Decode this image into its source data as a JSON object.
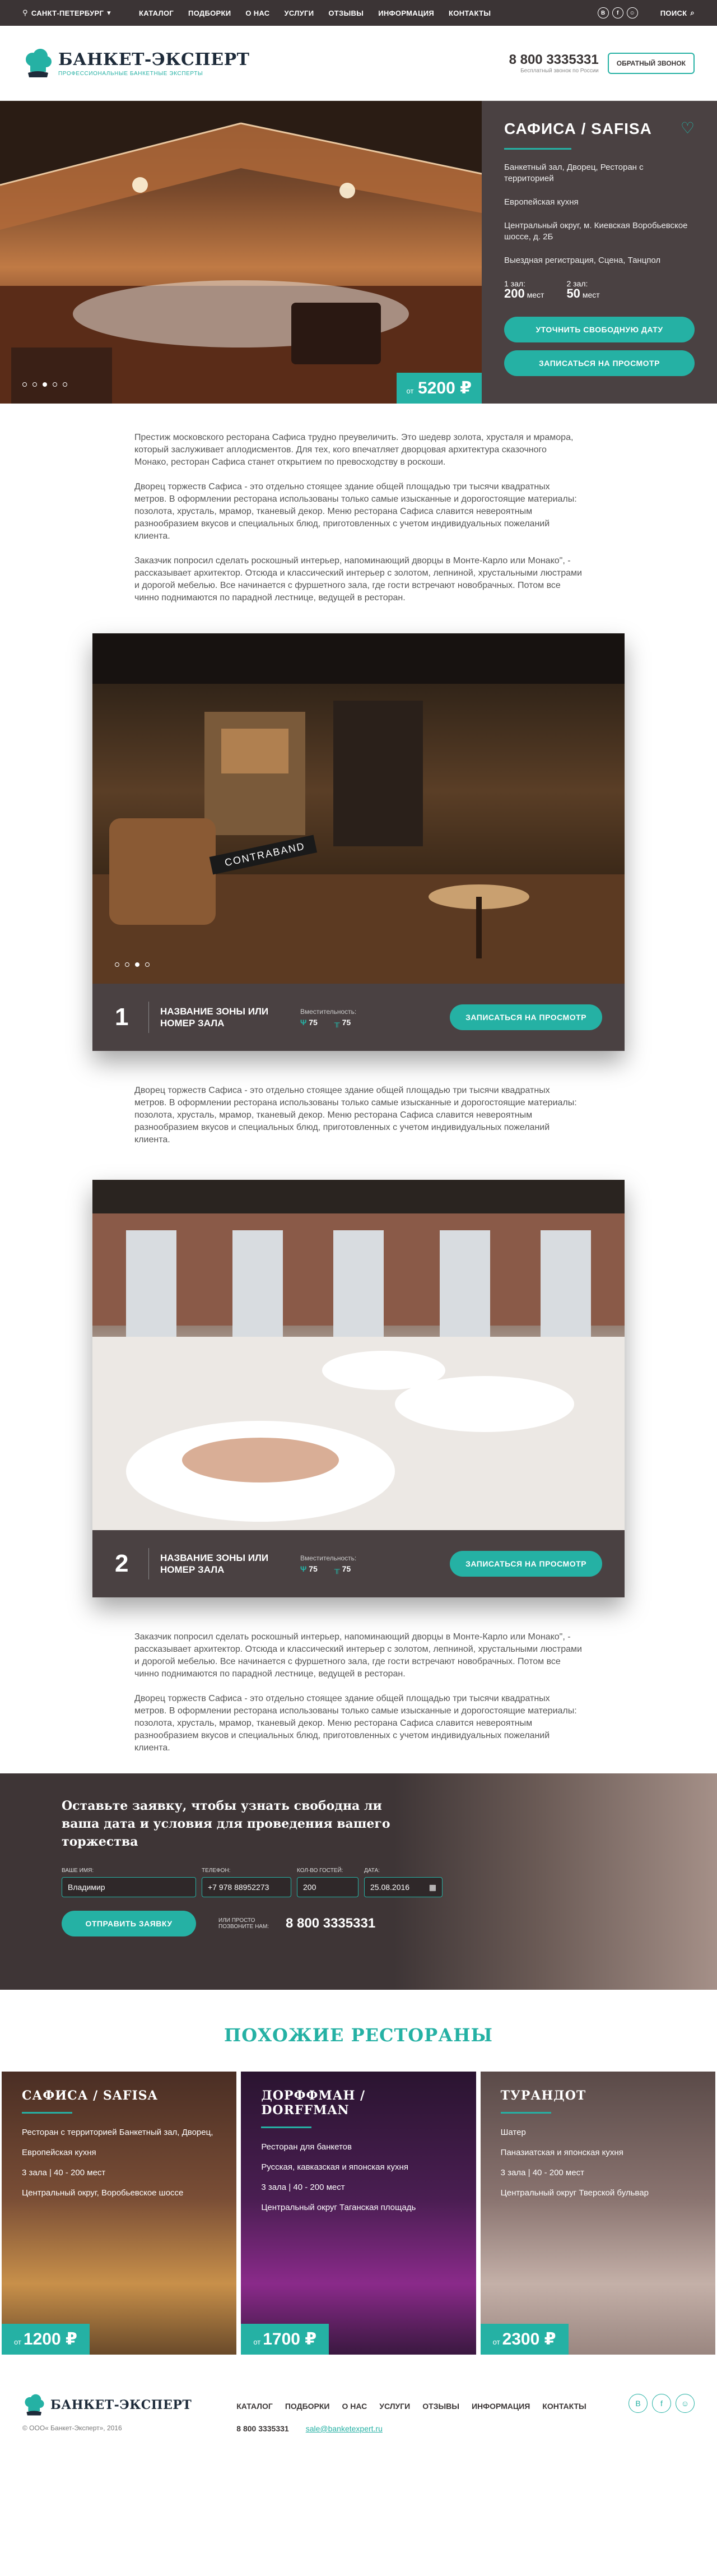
{
  "topbar": {
    "city": "САНКТ-ПЕТЕРБУРГ",
    "nav": [
      "КАТАЛОГ",
      "ПОДБОРКИ",
      "О НАС",
      "УСЛУГИ",
      "ОТЗЫВЫ",
      "ИНФОРМАЦИЯ",
      "КОНТАКТЫ"
    ],
    "social": [
      "В",
      "f",
      "☺"
    ],
    "search": "ПОИСК"
  },
  "header": {
    "logo_title": "БАНКЕТ-ЭКСПЕРТ",
    "logo_subtitle": "ПРОФЕССИОНАЛЬНЫЕ БАНКЕТНЫЕ ЭКСПЕРТЫ",
    "phone": "8 800 3335331",
    "phone_note": "Бесплатный звонок по России",
    "callback": "ОБРАТНЫЙ ЗВОНОК"
  },
  "hero": {
    "name": "САФИСА / SAFISA",
    "type": "Банкетный зал, Дворец, Ресторан с территорией",
    "cuisine": "Европейская кухня",
    "address": "Центральный округ, м. Киевская Воробьевское шоссе, д. 2Б",
    "extra": "Выездная регистрация, Сцена, Танцпол",
    "hall1_label": "1 зал:",
    "hall1_val": "200",
    "hall1_unit": "мест",
    "hall2_label": "2 зал:",
    "hall2_val": "50",
    "hall2_unit": "мест",
    "btn_date": "УТОЧНИТЬ СВОБОДНУЮ ДАТУ",
    "btn_view": "ЗАПИСАТЬСЯ НА ПРОСМОТР",
    "price_prefix": "от",
    "price": "5200 ₽"
  },
  "text1": [
    "Престиж московского ресторана Сафиса трудно преувеличить. Это шедевр золота, хрусталя и мрамора, который заслуживает аплодисментов. Для тех, кого впечатляет дворцовая архитектура сказочного Монако, ресторан Сафиса станет открытием по превосходству в роскоши.",
    "Дворец торжеств Сафиса - это отдельно стоящее здание общей площадью три тысячи квадратных метров. В оформлении ресторана использованы только самые изысканные и дорогостоящие материалы: позолота, хрусталь, мрамор, тканевый декор. Меню ресторана Сафиса славится невероятным разнообразием вкусов и специальных блюд, приготовленных с учетом индивидуальных пожеланий клиента.",
    "Заказчик попросил сделать роскошный интерьер, напоминающий дворцы в Монте-Карло или Монако\", - рассказывает архитектор. Отсюда и классический интерьер с золотом, лепниной, хрустальными люстрами и дорогой мебелью. Все начинается с фуршетного зала, где гости встречают новобрачных. Потом все чинно поднимаются по парадной лестнице, ведущей в ресторан."
  ],
  "zones": [
    {
      "num": "1",
      "name": "НАЗВАНИЕ ЗОНЫ ИЛИ НОМЕР ЗАЛА",
      "cap_label": "Вместительность:",
      "cap1": "75",
      "cap2": "75",
      "btn": "ЗАПИСАТЬСЯ НА ПРОСМОТР",
      "sign": "CONTRABAND"
    },
    {
      "num": "2",
      "name": "НАЗВАНИЕ ЗОНЫ ИЛИ НОМЕР ЗАЛА",
      "cap_label": "Вместительность:",
      "cap1": "75",
      "cap2": "75",
      "btn": "ЗАПИСАТЬСЯ НА ПРОСМОТР"
    }
  ],
  "text2": [
    "Дворец торжеств Сафиса - это отдельно стоящее здание общей площадью три тысячи квадратных метров. В оформлении ресторана использованы только самые изысканные и дорогостоящие материалы: позолота, хрусталь, мрамор, тканевый декор. Меню ресторана Сафиса славится невероятным разнообразием вкусов и специальных блюд, приготовленных с учетом индивидуальных пожеланий клиента."
  ],
  "text3": [
    "Заказчик попросил сделать роскошный интерьер, напоминающий дворцы в Монте-Карло или Монако\", - рассказывает архитектор. Отсюда и классический интерьер с золотом, лепниной, хрустальными люстрами и дорогой мебелью. Все начинается с фуршетного зала, где гости встречают новобрачных. Потом все чинно поднимаются по парадной лестнице, ведущей в ресторан.",
    "Дворец торжеств Сафиса - это отдельно стоящее здание общей площадью три тысячи квадратных метров. В оформлении ресторана использованы только самые изысканные и дорогостоящие материалы: позолота, хрусталь, мрамор, тканевый декор. Меню ресторана Сафиса славится невероятным разнообразием вкусов и специальных блюд, приготовленных с учетом индивидуальных пожеланий клиента."
  ],
  "request": {
    "title": "Оставьте заявку, чтобы узнать свободна ли ваша дата и условия для проведения вашего торжества",
    "name_label": "ВАШЕ ИМЯ:",
    "name_val": "Владимир",
    "phone_label": "ТЕЛЕФОН:",
    "phone_val": "+7 978 88952273",
    "guests_label": "КОЛ-ВО ГОСТЕЙ:",
    "guests_val": "200",
    "date_label": "ДАТА:",
    "date_val": "25.08.2016",
    "btn": "ОТПРАВИТЬ ЗАЯВКУ",
    "or": "ИЛИ ПРОСТО ПОЗВОНИТЕ НАМ:",
    "phone": "8 800 3335331"
  },
  "similar": {
    "title": "ПОХОЖИЕ РЕСТОРАНЫ",
    "cards": [
      {
        "name": "САФИСА / SAFISA",
        "type": "Ресторан с территорией Банкетный зал, Дворец,",
        "cuisine": "Европейская кухня",
        "halls": "3 зала | 40 - 200 мест",
        "addr": "Центральный округ, Воробьевское шоссе",
        "price_prefix": "от",
        "price": "1200 ₽"
      },
      {
        "name": "ДОРФФМАН / DORFFMAN",
        "type": "Ресторан для банкетов",
        "cuisine": "Русская, кавказская и японская кухня",
        "halls": "3 зала | 40 - 200 мест",
        "addr": "Центральный округ Таганская площадь",
        "price_prefix": "от",
        "price": "1700 ₽"
      },
      {
        "name": "ТУРАНДОТ",
        "type": "Шатер",
        "cuisine": "Паназиатская и японская кухня",
        "halls": "3 зала | 40 - 200 мест",
        "addr": "Центральный округ Тверской бульвар",
        "price_prefix": "от",
        "price": "2300 ₽"
      }
    ]
  },
  "footer": {
    "logo_title": "БАНКЕТ-ЭКСПЕРТ",
    "copyright": "© ООО« Банкет-Эксперт», 2016",
    "nav": [
      "КАТАЛОГ",
      "ПОДБОРКИ",
      "О НАС",
      "УСЛУГИ",
      "ОТЗЫВЫ",
      "ИНФОРМАЦИЯ",
      "КОНТАКТЫ"
    ],
    "phone": "8 800 3335331",
    "email": "sale@banketexpert.ru",
    "social": [
      "В",
      "f",
      "☺"
    ]
  },
  "colors": {
    "accent": "#25b1a4",
    "dark": "#3b3435",
    "panel": "#4a4142"
  }
}
